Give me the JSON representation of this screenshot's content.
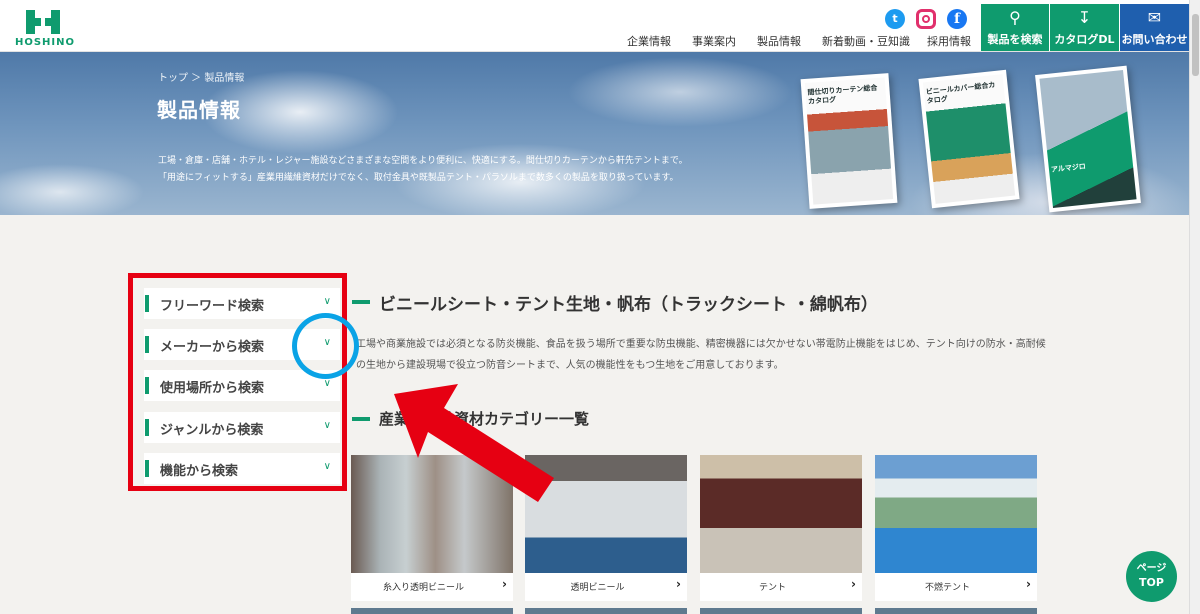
{
  "header": {
    "logo_text": "HOSHINO",
    "nav": [
      "企業情報",
      "事業案内",
      "製品情報",
      "新着動画・豆知識",
      "採用情報"
    ],
    "buttons": {
      "search": "製品を検索",
      "catalog": "カタログDL",
      "contact": "お問い合わせ"
    },
    "social_icons": [
      "twitter-icon",
      "instagram-icon",
      "facebook-icon"
    ]
  },
  "hero": {
    "breadcrumb": "トップ ＞ 製品情報",
    "title": "製品情報",
    "description_line1": "工場・倉庫・店舗・ホテル・レジャー施設などさまざまな空間をより便利に、快適にする。間仕切りカーテンから軒先テントまで。",
    "description_line2": "「用途にフィットする」産業用繊維資材だけでなく、取付金具や既製品テント・パラソルまで数多くの製品を取り扱っています。",
    "catalogs": [
      "間仕切りカーテン総合カタログ",
      "ビニールカバー総合カタログ",
      "アルマジロ"
    ]
  },
  "sidebar": {
    "items": [
      {
        "label": "フリーワード検索"
      },
      {
        "label": "メーカーから検索"
      },
      {
        "label": "使用場所から検索"
      },
      {
        "label": "ジャンルから検索"
      },
      {
        "label": "機能から検索"
      }
    ]
  },
  "main": {
    "section_title": "ビニールシート・テント生地・帆布（トラックシート ・綿帆布）",
    "desc_line1": "工場や商業施設では必須となる防炎機能、食品を扱う場所で重要な防虫機能、精密機器には欠かせない帯電防止機能をはじめ、テント向けの防水・高耐候",
    "desc_line2": "の生地から建設現場で役立つ防音シートまで、人気の機能性をもつ生地をご用意しております。",
    "sub_title": "産業用繊維資材カテゴリー一覧",
    "cards": [
      {
        "caption": "糸入り透明ビニール"
      },
      {
        "caption": "透明ビニール"
      },
      {
        "caption": "テント"
      },
      {
        "caption": "不燃テント"
      }
    ]
  },
  "page_top": {
    "line1": "ページ",
    "line2": "TOP"
  },
  "colors": {
    "brand_green": "#0f9b6e",
    "annotation_red": "#e60012",
    "annotation_blue": "#0aa3e6",
    "contact_blue": "#1f5fae"
  }
}
